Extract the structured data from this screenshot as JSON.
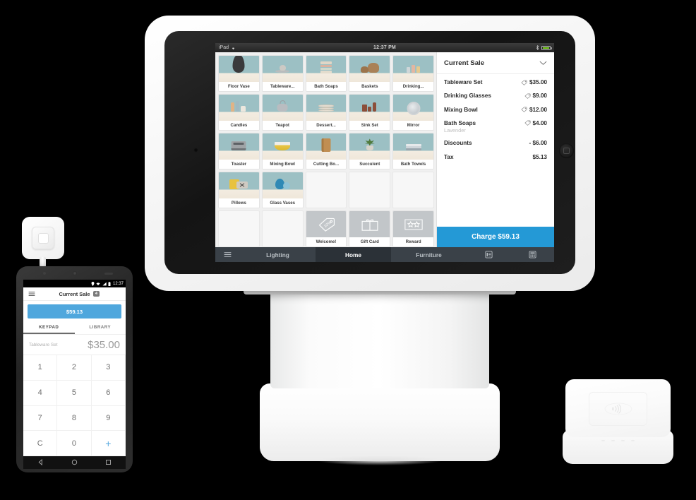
{
  "ipad": {
    "status_bar": {
      "device": "iPad",
      "time": "12:37 PM",
      "wifi_icon": "wifi-icon",
      "bluetooth_icon": "bluetooth-icon",
      "battery_icon": "battery-icon"
    },
    "products": [
      {
        "label": "Floor Vase",
        "kind": "vase"
      },
      {
        "label": "Tableware...",
        "kind": "cup"
      },
      {
        "label": "Bath Soaps",
        "kind": "soaps"
      },
      {
        "label": "Baskets",
        "kind": "baskets"
      },
      {
        "label": "Drinking...",
        "kind": "glasses"
      },
      {
        "label": "Candles",
        "kind": "candles"
      },
      {
        "label": "Teapot",
        "kind": "teapot"
      },
      {
        "label": "Dessert...",
        "kind": "plates"
      },
      {
        "label": "Sink Set",
        "kind": "sinkset"
      },
      {
        "label": "Mirror",
        "kind": "mirror"
      },
      {
        "label": "Toaster",
        "kind": "toaster"
      },
      {
        "label": "Mixing Bowl",
        "kind": "bowl"
      },
      {
        "label": "Cutting Bo...",
        "kind": "board"
      },
      {
        "label": "Succulent",
        "kind": "plant"
      },
      {
        "label": "Bath Towels",
        "kind": "towels"
      },
      {
        "label": "Pillows",
        "kind": "pillows"
      },
      {
        "label": "Glass Vases",
        "kind": "gvases"
      }
    ],
    "actions": [
      {
        "label": "Welcome!",
        "icon": "discount-tag-icon",
        "value": "10%"
      },
      {
        "label": "Gift Card",
        "icon": "gift-card-icon"
      },
      {
        "label": "Reward",
        "icon": "reward-stars-icon"
      }
    ],
    "cart": {
      "title": "Current Sale",
      "collapse_icon": "chevron-down-icon",
      "items": [
        {
          "name": "Tableware Set",
          "sub": "",
          "price": "$35.00",
          "has_tag": true
        },
        {
          "name": "Drinking Glasses",
          "sub": "",
          "price": "$9.00",
          "has_tag": true
        },
        {
          "name": "Mixing Bowl",
          "sub": "",
          "price": "$12.00",
          "has_tag": true
        },
        {
          "name": "Bath Soaps",
          "sub": "Lavender",
          "price": "$4.00",
          "has_tag": true
        },
        {
          "name": "Discounts",
          "sub": "",
          "price": "- $6.00",
          "has_tag": false
        },
        {
          "name": "Tax",
          "sub": "",
          "price": "$5.13",
          "has_tag": false
        }
      ],
      "charge_label": "Charge $59.13",
      "charge_color": "#2499d6"
    },
    "tabbar": {
      "menu_icon": "hamburger-menu-icon",
      "tabs": [
        {
          "label": "Lighting",
          "active": false
        },
        {
          "label": "Home",
          "active": true
        },
        {
          "label": "Furniture",
          "active": false
        }
      ],
      "icons": [
        "receipt-list-icon",
        "keypad-calculator-icon"
      ]
    }
  },
  "phone": {
    "status_bar": {
      "time": "12:37",
      "location_icon": "location-icon",
      "wifi_icon": "wifi-icon",
      "signal_icon": "signal-icon",
      "battery_icon": "battery-icon"
    },
    "appbar": {
      "menu_icon": "hamburger-menu-icon",
      "title": "Current Sale",
      "badge": "4"
    },
    "total_button": "$59.13",
    "tabs": [
      {
        "label": "KEYPAD",
        "active": true
      },
      {
        "label": "LIBRARY",
        "active": false
      }
    ],
    "amount_row": {
      "label": "Tableware Set",
      "amount": "$35.00"
    },
    "keypad": [
      "1",
      "2",
      "3",
      "4",
      "5",
      "6",
      "7",
      "8",
      "9",
      "C",
      "0",
      "+"
    ],
    "nav": {
      "back_icon": "nav-back-icon",
      "home_icon": "nav-home-icon",
      "recents_icon": "nav-recents-icon"
    }
  },
  "devices": {
    "square_reader": {
      "name": "square-card-reader",
      "logo": "square-logo-icon"
    },
    "contactless_reader": {
      "name": "contactless-chip-reader",
      "icon": "nfc-contactless-icon",
      "led_count": 4
    }
  }
}
